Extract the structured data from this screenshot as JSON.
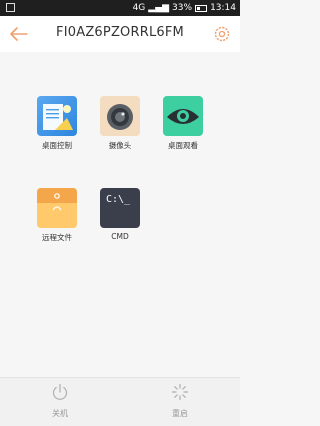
{
  "statusbar": {
    "network": "4G",
    "battery": "33%",
    "time": "13:14"
  },
  "appbar": {
    "title": "FI0AZ6PZORRL6FM",
    "accent_color": "#f0a070"
  },
  "tiles": [
    {
      "label": "桌面控制",
      "icon": "desktop-control-icon"
    },
    {
      "label": "摄像头",
      "icon": "camera-icon"
    },
    {
      "label": "桌面观看",
      "icon": "eye-icon"
    },
    {
      "label": "远程文件",
      "icon": "folder-icon"
    },
    {
      "label": "CMD",
      "icon": "terminal-icon",
      "glyph": "C:\\_"
    }
  ],
  "bottom": {
    "shutdown_label": "关机",
    "restart_label": "重启"
  }
}
